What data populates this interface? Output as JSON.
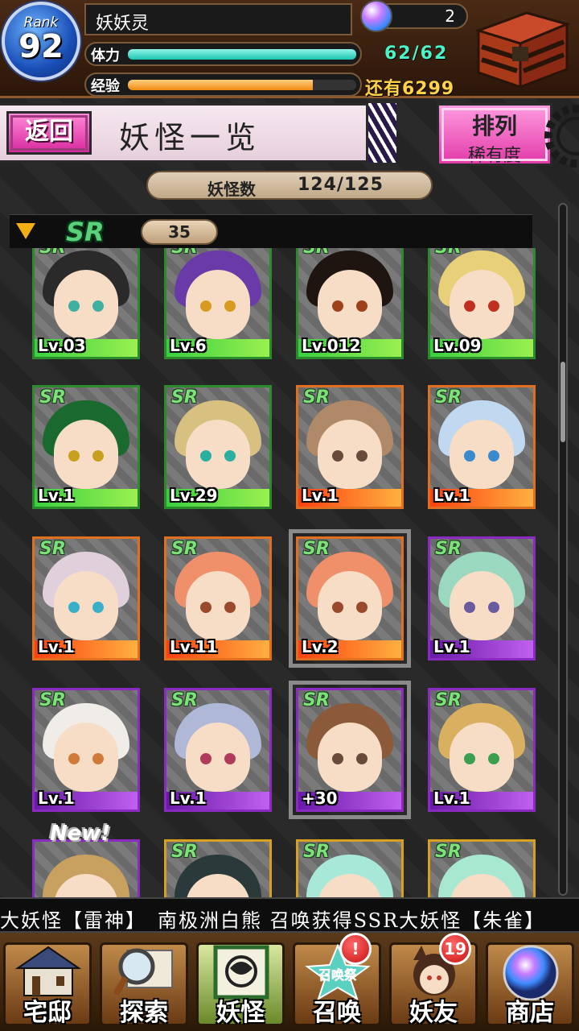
{
  "player": {
    "rank_label": "Rank",
    "rank": "92",
    "name": "妖妖灵",
    "gems": "2",
    "stamina_label": "体力",
    "stamina_value": "62/62",
    "stamina_fraction": 1.0,
    "exp_label": "经验",
    "exp_remaining": "还有6299",
    "exp_fraction": 0.81
  },
  "header": {
    "back_label": "返回",
    "title": "妖怪一览",
    "sort_title": "排列",
    "sort_value": "稀有度"
  },
  "count": {
    "label": "妖怪数",
    "value": "124/125"
  },
  "group": {
    "rarity": "SR",
    "count": "35"
  },
  "cards": [
    {
      "rarity": "SR",
      "level": "Lv.03",
      "frame": "green",
      "hair": "#2a2a2a",
      "eye": "#3fb0a0"
    },
    {
      "rarity": "SR",
      "level": "Lv.6",
      "frame": "green",
      "hair": "#6a3aa8",
      "eye": "#d89a20"
    },
    {
      "rarity": "SR",
      "level": "Lv.012",
      "frame": "green",
      "hair": "#1e1410",
      "eye": "#a0401a"
    },
    {
      "rarity": "SR",
      "level": "Lv.09",
      "frame": "green",
      "hair": "#e8d07a",
      "eye": "#c03020"
    },
    {
      "rarity": "SR",
      "level": "Lv.1",
      "frame": "green",
      "hair": "#1a6a30",
      "eye": "#c8a020"
    },
    {
      "rarity": "SR",
      "level": "Lv.29",
      "frame": "green",
      "hair": "#d8c080",
      "eye": "#2ab0a0"
    },
    {
      "rarity": "SR",
      "level": "Lv.1",
      "frame": "orange",
      "hair": "#b08a68",
      "eye": "#6a4a3a"
    },
    {
      "rarity": "SR",
      "level": "Lv.1",
      "frame": "orange",
      "hair": "#c0d8f0",
      "eye": "#3a8ad0"
    },
    {
      "rarity": "SR",
      "level": "Lv.1",
      "frame": "orange",
      "hair": "#e0d0dc",
      "eye": "#3ab0c8"
    },
    {
      "rarity": "SR",
      "level": "Lv.11",
      "frame": "orange",
      "hair": "#f0906a",
      "eye": "#9a4a2a"
    },
    {
      "rarity": "SR",
      "level": "Lv.2",
      "frame": "orange",
      "hair": "#f0906a",
      "eye": "#9a4a2a"
    },
    {
      "rarity": "SR",
      "level": "Lv.1",
      "frame": "purple",
      "hair": "#9ad8c0",
      "eye": "#6a5aa0"
    },
    {
      "rarity": "SR",
      "level": "Lv.1",
      "frame": "purple",
      "hair": "#f0ece8",
      "eye": "#d07a3a"
    },
    {
      "rarity": "SR",
      "level": "Lv.1",
      "frame": "purple",
      "hair": "#b0b8d8",
      "eye": "#b03a5a"
    },
    {
      "rarity": "SR",
      "level": "+30",
      "frame": "purple",
      "hair": "#8a5a3a",
      "eye": "#6a4a3a"
    },
    {
      "rarity": "SR",
      "level": "Lv.1",
      "frame": "purple",
      "hair": "#d8b060",
      "eye": "#3aa050"
    },
    {
      "rarity": "",
      "level": "",
      "frame": "purple",
      "hair": "#c8a060",
      "eye": "#6a4a3a"
    },
    {
      "rarity": "SR",
      "level": "",
      "frame": "gold",
      "hair": "#2a3a3a",
      "eye": "#3a6a6a"
    },
    {
      "rarity": "SR",
      "level": "",
      "frame": "gold",
      "hair": "#a8e8d8",
      "eye": "#d03a3a"
    },
    {
      "rarity": "SR",
      "level": "",
      "frame": "gold",
      "hair": "#a8e8d0",
      "eye": "#3a8a8a"
    }
  ],
  "new_tag": "New!",
  "ticker": "大妖怪【雷神】　南极洲白熊 召唤获得SSR大妖怪【朱雀】",
  "nav": {
    "home": "宅邸",
    "explore": "探索",
    "yokai": "妖怪",
    "summon": "召唤",
    "summon_art": "召唤祭",
    "summon_badge": "!",
    "friends": "妖友",
    "friends_badge": "19",
    "shop": "商店"
  },
  "colors": {
    "accent_pink": "#e23aa8",
    "stamina": "#1cc4b0",
    "exp": "#f08a10"
  }
}
